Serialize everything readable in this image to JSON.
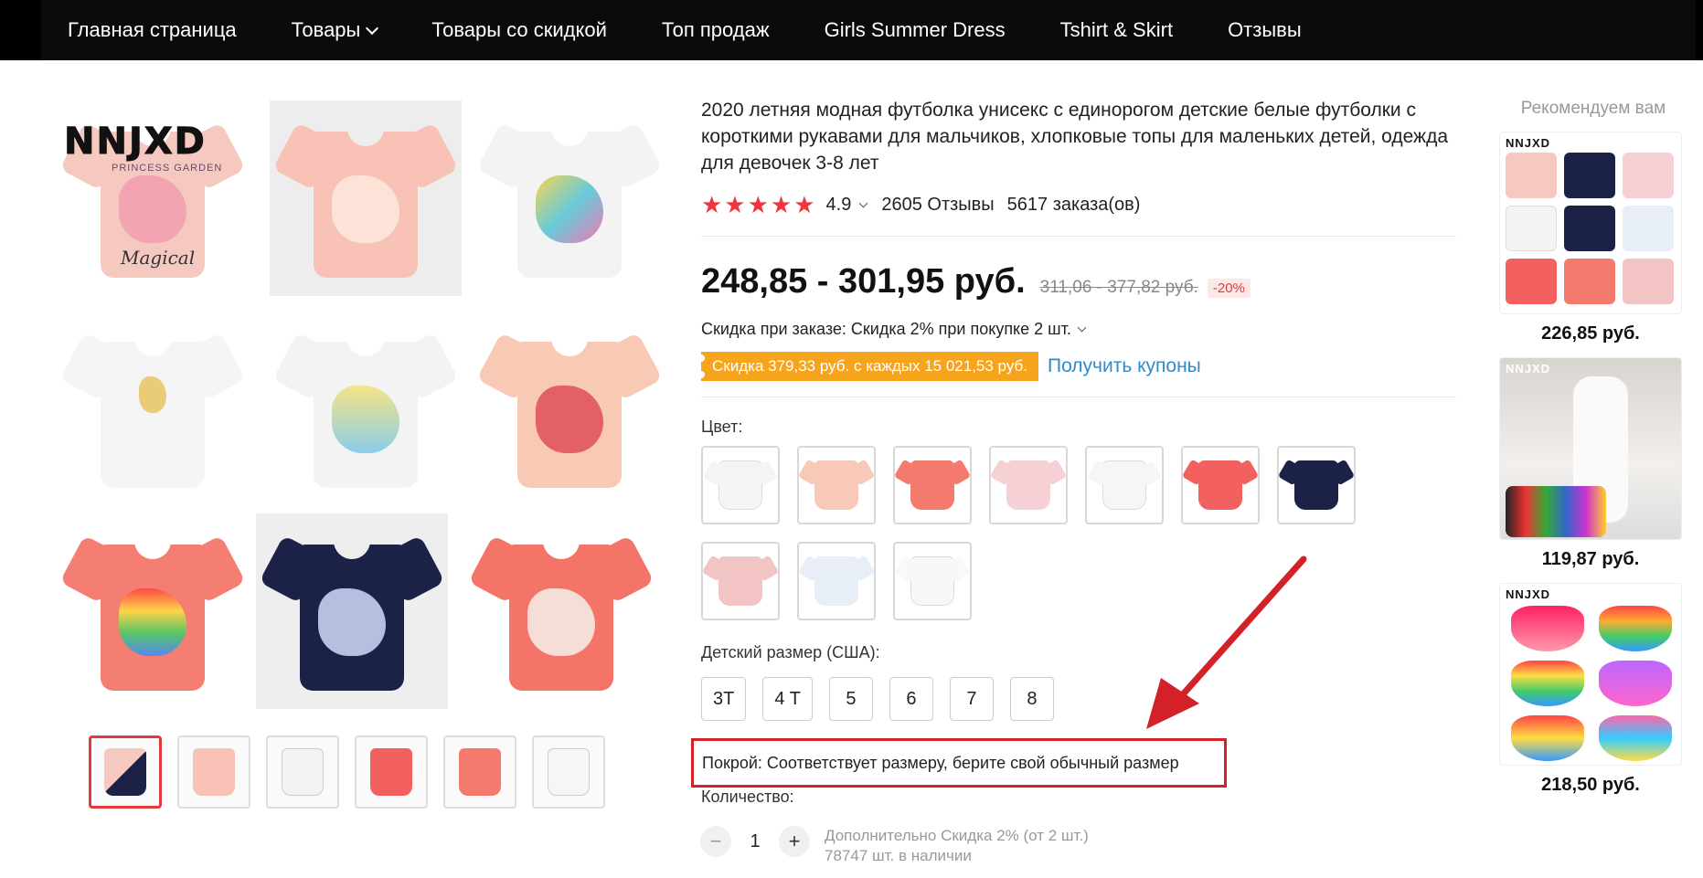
{
  "nav": {
    "items": [
      "Главная страница",
      "Товары",
      "Товары со скидкой",
      "Топ продаж",
      "Girls Summer Dress",
      "Tshirt & Skirt",
      "Отзывы"
    ]
  },
  "gallery": {
    "brand": "NNJXD",
    "brand_sub": "PRINCESS GARDEN",
    "script_text": "Magical"
  },
  "product": {
    "title": "2020 летняя модная футболка унисекс с единорогом детские белые футболки с короткими рукавами для мальчиков, хлопковые топы для маленьких детей, одежда для девочек 3-8 лет",
    "rating": "4.9",
    "reviews": "2605 Отзывы",
    "orders": "5617 заказа(ов)",
    "price": "248,85 - 301,95 руб.",
    "old_price": "311,06 - 377,82 руб.",
    "discount_badge": "-20%",
    "bulk_discount": "Скидка при заказе: Скидка 2% при покупке 2 шт.",
    "coupon_tag": "Скидка 379,33 руб. с каждых 15 021,53 руб.",
    "coupon_link": "Получить купоны",
    "color_label": "Цвет:",
    "size_label": "Детский размер (США):",
    "sizes": [
      "3T",
      "4 T",
      "5",
      "6",
      "7",
      "8"
    ],
    "fit_text": "Покрой: Соответствует размеру, берите свой обычный размер",
    "qty_label": "Количество:",
    "qty_value": "1",
    "qty_minus": "−",
    "qty_plus": "+",
    "qty_note_1": "Дополнительно Скидка 2% (от 2 шт.)",
    "qty_note_2": "78747 шт. в наличии"
  },
  "swatch_colors": [
    "#f4f4f4",
    "#f8c8b8",
    "#f47a6e",
    "#f5d0d5",
    "#f6f6f6",
    "#f26060",
    "#1c2247",
    "#f3c4c4",
    "#e8eef6",
    "#f8f8f8"
  ],
  "recommend": {
    "title": "Рекомендуем вам",
    "items": [
      {
        "brand": "NNJXD",
        "price": "226,85 руб."
      },
      {
        "brand": "NNJXD",
        "price": "119,87 руб."
      },
      {
        "brand": "NNJXD",
        "price": "218,50 руб."
      }
    ]
  },
  "colors": {
    "accent_red": "#e4393c",
    "star": "#f0353f",
    "coupon": "#f7a41d",
    "link": "#2e8bc9",
    "highlight_box": "#d3212a"
  }
}
